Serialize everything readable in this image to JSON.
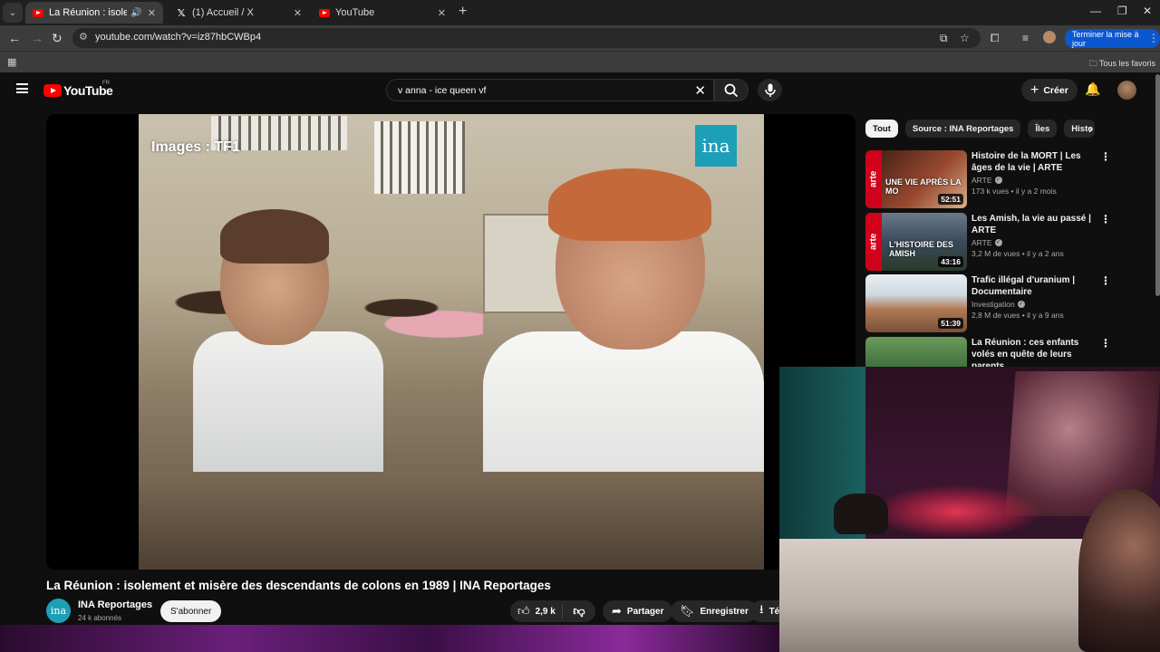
{
  "browser": {
    "tabs": [
      {
        "title": "La Réunion : isolement et m",
        "icon": "youtube-favicon",
        "active": true,
        "audio": true
      },
      {
        "title": "(1) Accueil / X",
        "icon": "x-favicon",
        "active": false
      },
      {
        "title": "YouTube",
        "icon": "youtube-favicon",
        "active": false
      }
    ],
    "url": "youtube.com/watch?v=iz87hbCWBp4",
    "update_button": "Terminer la mise à jour",
    "bookmarks_all": "Tous les favoris"
  },
  "youtube": {
    "logo_text": "YouTube",
    "region": "FR",
    "search_query": "v anna - ice queen vf",
    "create_label": "Créer"
  },
  "video": {
    "overlay_caption": "Images : TF1",
    "watermark": "ina",
    "title": "La Réunion : isolement et misère des descendants de colons en 1989 | INA Reportages",
    "channel": {
      "name": "INA Reportages",
      "subscribers": "24 k abonnés",
      "avatar_text": "ina"
    },
    "subscribe_label": "S'abonner",
    "likes": "2,9 k",
    "share_label": "Partager",
    "save_label": "Enregistrer",
    "download_label": "Té"
  },
  "sidebar": {
    "chips": [
      {
        "label": "Tout",
        "active": true
      },
      {
        "label": "Source : INA Reportages",
        "active": false
      },
      {
        "label": "Îles",
        "active": false
      },
      {
        "label": "Histo",
        "active": false
      }
    ],
    "recommendations": [
      {
        "title": "Histoire de la MORT | Les âges de la vie | ARTE",
        "channel": "ARTE",
        "views": "173 k vues",
        "age": "il y a 2 mois",
        "duration": "52:51",
        "thumb_text": "UNE VIE APRÈS LA MO",
        "thumb_color": "#7a2a20"
      },
      {
        "title": "Les Amish, la vie au passé | ARTE",
        "channel": "ARTE",
        "views": "3,2 M de vues",
        "age": "il y a 2 ans",
        "duration": "43:16",
        "thumb_text": "L'HISTOIRE DES AMISH",
        "thumb_color": "#4a5a6a"
      },
      {
        "title": "Trafic illégal d'uranium | Documentaire",
        "channel": "Investigation",
        "views": "2,8 M de vues",
        "age": "il y a 9 ans",
        "duration": "51:39",
        "thumb_text": "",
        "thumb_color": "#b07a55"
      },
      {
        "title": "La Réunion : ces enfants volés en quête de leurs parents",
        "channel": "",
        "views": "",
        "age": "",
        "duration": "",
        "thumb_text": "",
        "thumb_color": "#3a6a3a"
      }
    ]
  },
  "colors": {
    "accent_red": "#ff0000",
    "update_blue": "#0b57d0",
    "ina_teal": "#1e9fb8",
    "arte_red": "#d0021b"
  }
}
